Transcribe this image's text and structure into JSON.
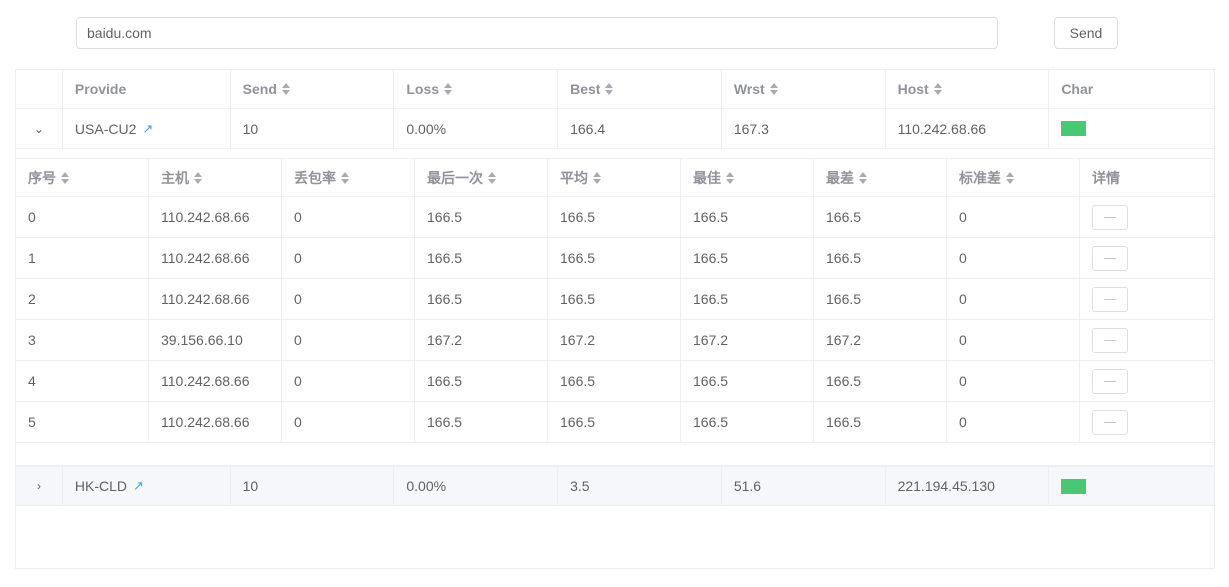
{
  "search": {
    "value": "baidu.com"
  },
  "send_button": "Send",
  "outer_headers": [
    "Provide",
    "Send",
    "Loss",
    "Best",
    "Wrst",
    "Host",
    "Char"
  ],
  "rows": [
    {
      "provide": "USA-CU2",
      "send": "10",
      "loss": "0.00%",
      "best": "166.4",
      "wrst": "167.3",
      "host": "110.242.68.66",
      "expanded": true
    },
    {
      "provide": "HK-CLD",
      "send": "10",
      "loss": "0.00%",
      "best": "3.5",
      "wrst": "51.6",
      "host": "221.194.45.130",
      "expanded": false
    }
  ],
  "inner_headers": [
    "序号",
    "主机",
    "丢包率",
    "最后一次",
    "平均",
    "最佳",
    "最差",
    "标准差",
    "详情"
  ],
  "inner_rows": [
    [
      "0",
      "110.242.68.66",
      "0",
      "166.5",
      "166.5",
      "166.5",
      "166.5",
      "0"
    ],
    [
      "1",
      "110.242.68.66",
      "0",
      "166.5",
      "166.5",
      "166.5",
      "166.5",
      "0"
    ],
    [
      "2",
      "110.242.68.66",
      "0",
      "166.5",
      "166.5",
      "166.5",
      "166.5",
      "0"
    ],
    [
      "3",
      "39.156.66.10",
      "0",
      "167.2",
      "167.2",
      "167.2",
      "167.2",
      "0"
    ],
    [
      "4",
      "110.242.68.66",
      "0",
      "166.5",
      "166.5",
      "166.5",
      "166.5",
      "0"
    ],
    [
      "5",
      "110.242.68.66",
      "0",
      "166.5",
      "166.5",
      "166.5",
      "166.5",
      "0"
    ]
  ],
  "colors": {
    "bar": "#48c774",
    "link": "#409eff"
  }
}
